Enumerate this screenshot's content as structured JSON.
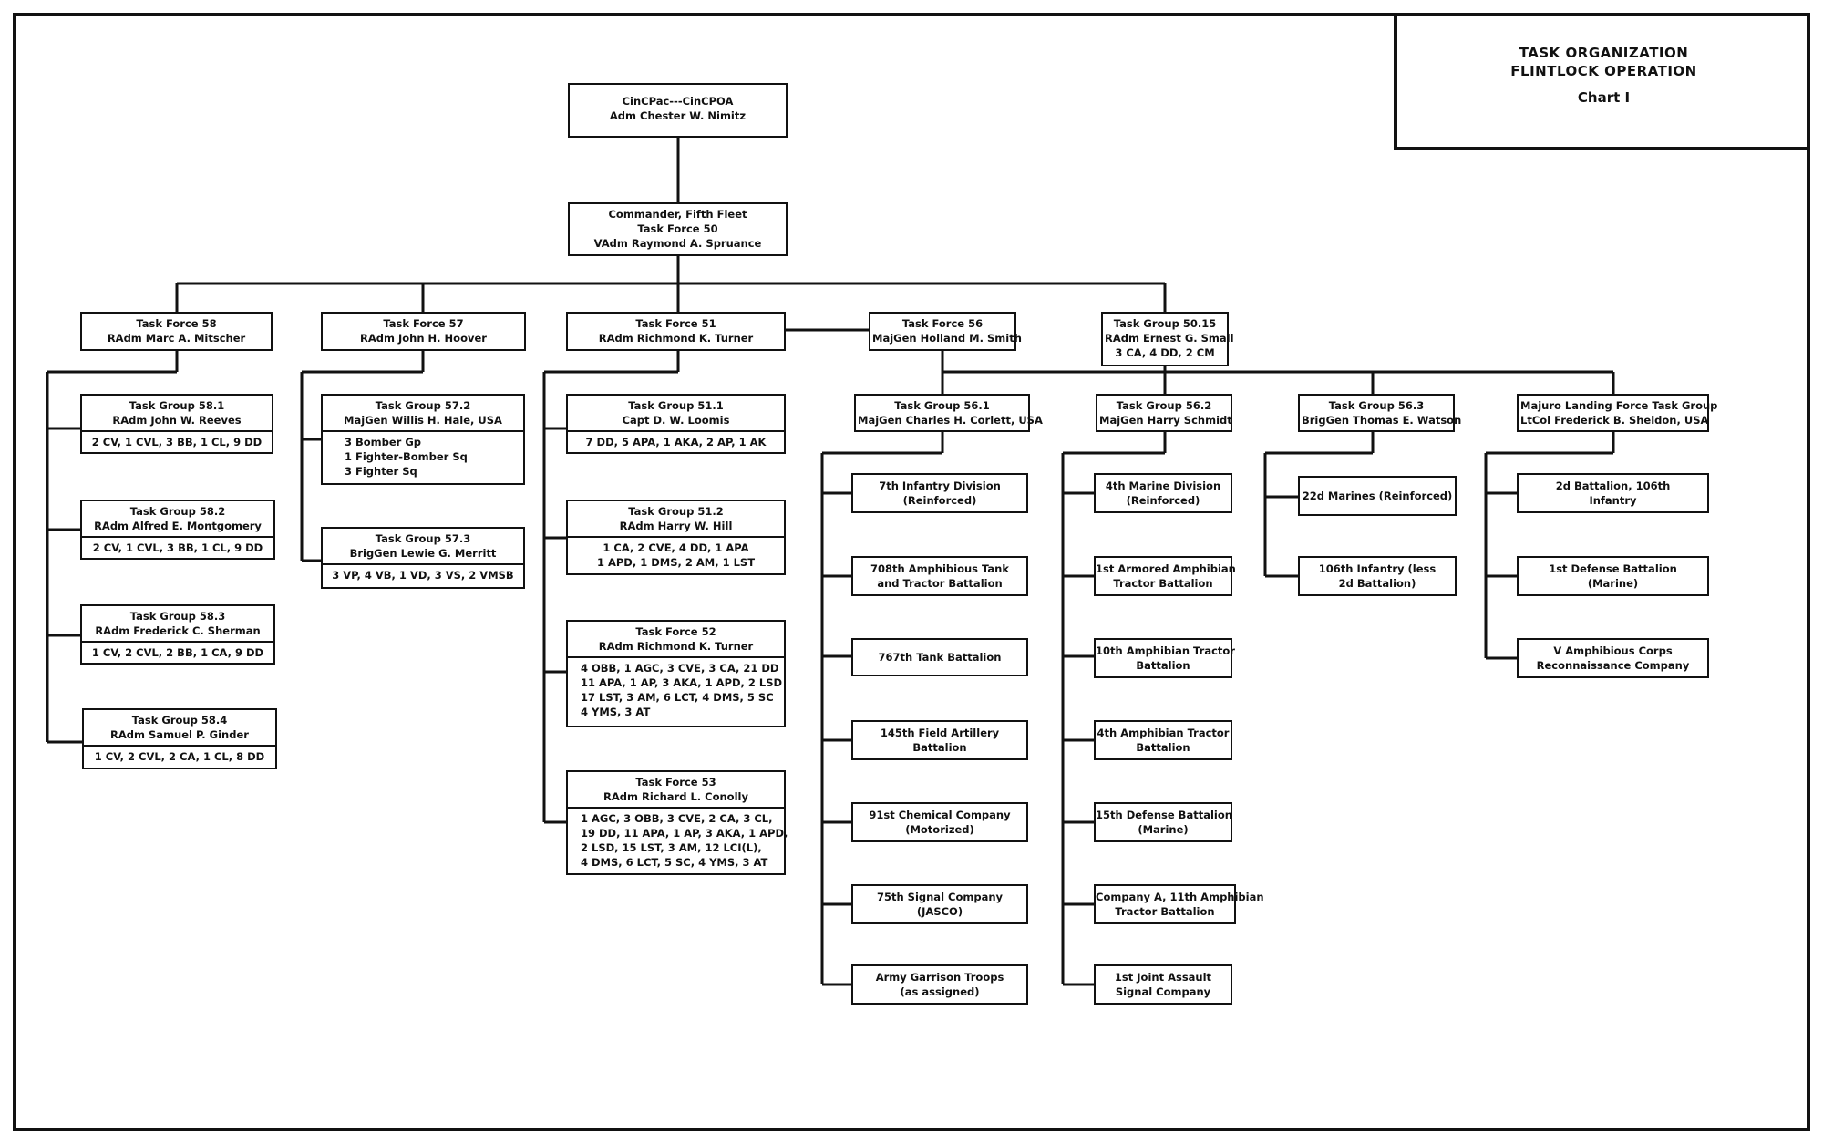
{
  "title": {
    "line1": "TASK  ORGANIZATION",
    "line2": "FLINTLOCK  OPERATION",
    "chart": "Chart  I"
  },
  "top": {
    "cincpac": [
      "CinCPac---CinCPOA",
      "Adm  Chester  W.  Nimitz"
    ],
    "fifth_fleet": [
      "Commander, Fifth Fleet",
      "Task Force 50",
      "VAdm Raymond A. Spruance"
    ]
  },
  "forces": {
    "tf58": [
      "Task Force 58",
      "RAdm Marc A. Mitscher"
    ],
    "tf57": [
      "Task Force 57",
      "RAdm John H. Hoover"
    ],
    "tf51": [
      "Task Force 51",
      "RAdm Richmond K. Turner"
    ],
    "tf56": [
      "Task Force 56",
      "MajGen Holland M. Smith"
    ],
    "tg5015": [
      "Task Group 50.15",
      "RAdm Ernest G. Small",
      "3 CA,  4 DD,  2 CM"
    ]
  },
  "tf58_groups": [
    {
      "head": [
        "Task Group 58.1",
        "RAdm John W. Reeves"
      ],
      "units": [
        "2 CV,  1 CVL,  3 BB,  1 CL,  9 DD"
      ]
    },
    {
      "head": [
        "Task Group 58.2",
        "RAdm Alfred E. Montgomery"
      ],
      "units": [
        "2 CV,  1 CVL,  3 BB,  1 CL,  9 DD"
      ]
    },
    {
      "head": [
        "Task Group 58.3",
        "RAdm Frederick C. Sherman"
      ],
      "units": [
        "1 CV,  2 CVL,  2 BB,  1 CA,  9 DD"
      ]
    },
    {
      "head": [
        "Task Group 58.4",
        "RAdm Samuel P. Ginder"
      ],
      "units": [
        "1 CV,  2 CVL,  2 CA,  1 CL,  8 DD"
      ]
    }
  ],
  "tf57_groups": [
    {
      "head": [
        "Task Group 57.2",
        "MajGen Willis H. Hale, USA"
      ],
      "units": [
        "3 Bomber Gp",
        "1 Fighter-Bomber Sq",
        "3 Fighter Sq"
      ]
    },
    {
      "head": [
        "Task Group 57.3",
        "BrigGen Lewie G. Merritt"
      ],
      "units": [
        "3 VP,  4 VB,  1 VD,  3 VS,  2 VMSB"
      ]
    }
  ],
  "tf51_groups": [
    {
      "head": [
        "Task Group 51.1",
        "Capt D. W. Loomis"
      ],
      "units": [
        "7 DD,  5 APA,  1 AKA,  2 AP,  1 AK"
      ]
    },
    {
      "head": [
        "Task Group 51.2",
        "RAdm Harry W. Hill"
      ],
      "units": [
        "1 CA,  2 CVE,  4 DD,  1 APA",
        "1 APD,  1 DMS,  2 AM,  1 LST"
      ]
    },
    {
      "head": [
        "Task Force 52",
        "RAdm Richmond K. Turner"
      ],
      "units": [
        "4 OBB,  1 AGC,  3 CVE,  3 CA,  21 DD",
        "11 APA,  1 AP,  3 AKA,  1 APD,  2 LSD",
        "17 LST,  3 AM,  6 LCT,  4 DMS,  5 SC",
        "4 YMS,  3 AT"
      ]
    },
    {
      "head": [
        "Task Force 53",
        "RAdm Richard L. Conolly"
      ],
      "units": [
        "1 AGC,  3 OBB,  3 CVE,  2 CA,  3 CL,",
        "19 DD,  11 APA,  1 AP,  3 AKA,  1 APD,",
        "2 LSD,  15 LST,  3 AM,  12 LCI(L),",
        "4 DMS,  6 LCT,  5 SC,  4 YMS,  3 AT"
      ]
    }
  ],
  "tf56_groups": {
    "tg561": {
      "head": [
        "Task Group 56.1",
        "MajGen Charles H. Corlett, USA"
      ],
      "units": [
        [
          "7th  Infantry  Division",
          "(Reinforced)"
        ],
        [
          "708th  Amphibious  Tank",
          "and  Tractor  Battalion"
        ],
        [
          "767th  Tank  Battalion"
        ],
        [
          "145th  Field  Artillery",
          "Battalion"
        ],
        [
          "91st  Chemical  Company",
          "(Motorized)"
        ],
        [
          "75th  Signal  Company",
          "(JASCO)"
        ],
        [
          "Army  Garrison  Troops",
          "(as  assigned)"
        ]
      ]
    },
    "tg562": {
      "head": [
        "Task Group 56.2",
        "MajGen Harry Schmidt"
      ],
      "units": [
        [
          "4th  Marine  Division",
          "(Reinforced)"
        ],
        [
          "1st  Armored  Amphibian",
          "Tractor  Battalion"
        ],
        [
          "10th  Amphibian  Tractor",
          "Battalion"
        ],
        [
          "4th  Amphibian  Tractor",
          "Battalion"
        ],
        [
          "15th  Defense  Battalion",
          "(Marine)"
        ],
        [
          "Company  A, 11th  Amphibian",
          "Tractor  Battalion"
        ],
        [
          "1st  Joint  Assault",
          "Signal  Company"
        ]
      ]
    },
    "tg563": {
      "head": [
        "Task Group 56.3",
        "BrigGen Thomas E. Watson"
      ],
      "units": [
        [
          "22d  Marines  (Reinforced)"
        ],
        [
          "106th  Infantry  (less",
          "2d  Battalion)"
        ]
      ]
    },
    "majuro": {
      "head": [
        "Majuro Landing Force  Task Group",
        "LtCol Frederick B. Sheldon, USA"
      ],
      "units": [
        [
          "2d  Battalion,  106th",
          "Infantry"
        ],
        [
          "1st  Defense  Battalion",
          "(Marine)"
        ],
        [
          "V  Amphibious  Corps",
          "Reconnaissance  Company"
        ]
      ]
    }
  }
}
